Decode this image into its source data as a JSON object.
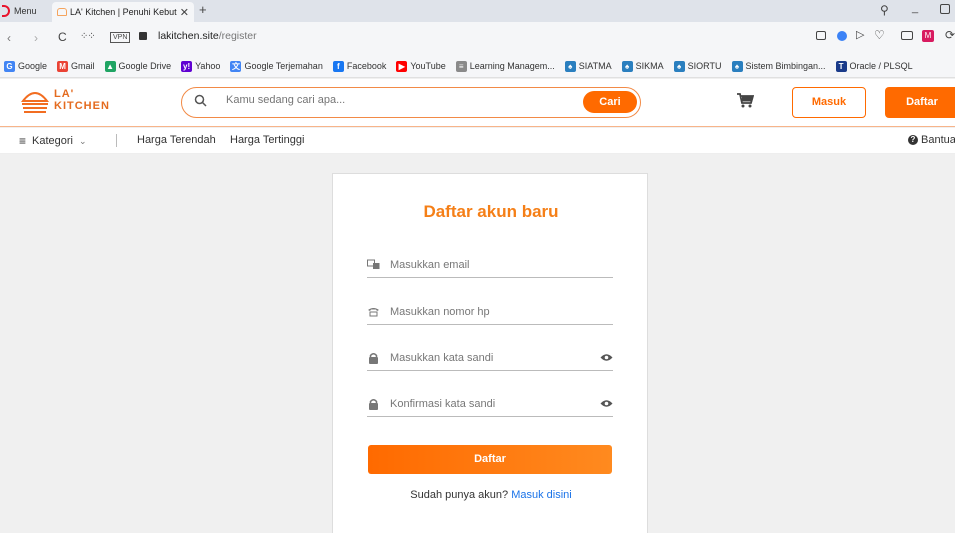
{
  "browser": {
    "menu_label": "Menu",
    "tab_title": "LA' Kitchen | Penuhi Kebutu",
    "new_tab": "+",
    "vpn_label": "VPN",
    "url_host": "lakitchen.site",
    "url_path": "/register",
    "bookmarks": [
      {
        "label": "Google",
        "icon": "google-icon",
        "color": "#4285f4",
        "glyph": "G"
      },
      {
        "label": "Gmail",
        "icon": "gmail-icon",
        "color": "#ea4335",
        "glyph": "M"
      },
      {
        "label": "Google Drive",
        "icon": "drive-icon",
        "color": "#1fa463",
        "glyph": "▲"
      },
      {
        "label": "Yahoo",
        "icon": "yahoo-icon",
        "color": "#6001d2",
        "glyph": "y!"
      },
      {
        "label": "Google Terjemahan",
        "icon": "translate-icon",
        "color": "#4285f4",
        "glyph": "文"
      },
      {
        "label": "Facebook",
        "icon": "facebook-icon",
        "color": "#1877f2",
        "glyph": "f"
      },
      {
        "label": "YouTube",
        "icon": "youtube-icon",
        "color": "#ff0000",
        "glyph": "▶"
      },
      {
        "label": "Learning Managem...",
        "icon": "lms-icon",
        "color": "#8a8a8a",
        "glyph": "≡"
      },
      {
        "label": "SIATMA",
        "icon": "atma-icon",
        "color": "#2a7fbf",
        "glyph": "♠"
      },
      {
        "label": "SIKMA",
        "icon": "atma-icon",
        "color": "#2a7fbf",
        "glyph": "♠"
      },
      {
        "label": "SIORTU",
        "icon": "atma-icon",
        "color": "#2a7fbf",
        "glyph": "♠"
      },
      {
        "label": "Sistem Bimbingan...",
        "icon": "atma-icon",
        "color": "#2a7fbf",
        "glyph": "♠"
      },
      {
        "label": "Oracle / PLSQL",
        "icon": "oracle-icon",
        "color": "#1a3b8a",
        "glyph": "T"
      }
    ]
  },
  "site": {
    "logo_line1": "LA'",
    "logo_line2": "KITCHEN",
    "search_placeholder": "Kamu sedang cari apa...",
    "search_button": "Cari",
    "login_button": "Masuk",
    "register_button": "Daftar",
    "nav": {
      "category": "Kategori",
      "lowest_price": "Harga Terendah",
      "highest_price": "Harga Tertinggi",
      "help": "Bantuan"
    }
  },
  "form": {
    "title": "Daftar akun baru",
    "email_placeholder": "Masukkan email",
    "phone_placeholder": "Masukkan nomor hp",
    "password_placeholder": "Masukkan kata sandi",
    "confirm_placeholder": "Konfirmasi kata sandi",
    "submit_label": "Daftar",
    "footer_text": "Sudah punya akun?",
    "footer_link": "Masuk disini"
  },
  "colors": {
    "brand": "#ff6a00",
    "title": "#f57f17",
    "link": "#1a73e8"
  }
}
